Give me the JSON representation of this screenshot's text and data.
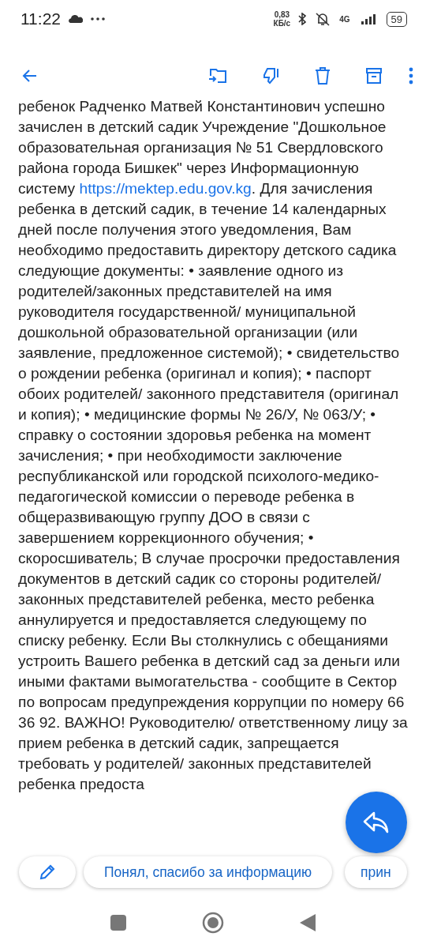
{
  "status_bar": {
    "time": "11:22",
    "speed_value": "0,83",
    "speed_unit": "КБ/с",
    "network": "4G",
    "battery": "59"
  },
  "message": {
    "text_before_link": "ребенок Радченко Матвей Константинович успешно зачислен в детский садик Учреждение \"Дошкольное образовательная организация № 51 Свердловского района города Бишкек\" через Информационную систему",
    "link": "https://mektep.edu.gov.kg",
    "text_after_link": ". Для зачисления ребенка в детский садик, в течение 14 календарных дней после получения этого уведомления, Вам необходимо предоставить директору детского садика следующие документы:  •  заявление одного из родителей/законных представителей на имя руководителя государственной/ муниципальной дошкольной образовательной организации (или заявление, предложенное системой);  •  свидетельство о рождении ребенка (оригинал и копия);  •  паспорт обоих родителей/ законного представителя (оригинал и копия);  •  медицинские формы № 26/У, № 063/У;  •  справку о состоянии здоровья ребенка на момент зачисления;  •  при необходимости заключение республиканской или городской психолого-медико-педагогической комиссии о переводе ребенка в общеразвивающую группу ДОО в связи с завершением коррекционного обучения;  •  скоросшиватель; В случае просрочки предоставления документов в детский садик со стороны родителей/законных представителей ребенка, место ребенка аннулируется и предоставляется следующему по списку ребенку. Если Вы столкнулись с обещаниями устроить Вашего ребенка в детский сад за деньги или иными фактами вымогательства - сообщите в Сектор по вопросам предупреждения коррупции по номеру 66 36 92. ВАЖНО! Руководителю/ ответственному лицу за прием ребенка в детский садик, запрещается требовать у родителей/ законных представителей ребенка предоста"
  },
  "smart_replies": [
    "Понял, спасибо за информацию",
    "прин"
  ]
}
